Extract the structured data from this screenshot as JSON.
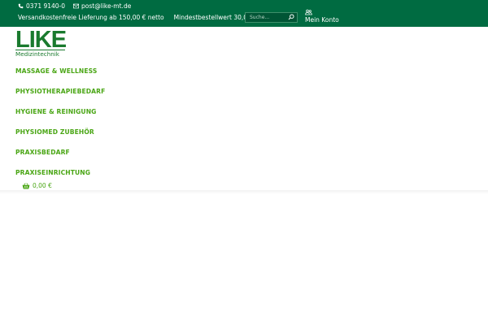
{
  "topbar": {
    "phone": "0371 9140-0",
    "email": "post@like-mt.de",
    "shipping_notice": "Versandkostenfreie Lieferung ab 150,00 € netto",
    "min_order": "Mindestbestellwert 30,00 € netto",
    "search_placeholder": "Suche...",
    "account_label": "Mein Konto",
    "icons": {
      "phone": "phone-icon",
      "email": "envelope-icon",
      "search": "search-icon",
      "account": "users-icon"
    }
  },
  "logo": {
    "word": "LIKE",
    "subtitle": "Medizintechnik"
  },
  "nav": {
    "items": [
      {
        "label": "MASSAGE & WELLNESS"
      },
      {
        "label": "PHYSIOTHERAPIEBEDARF"
      },
      {
        "label": "HYGIENE & REINIGUNG"
      },
      {
        "label": "PHYSIOMED ZUBEHÖR"
      },
      {
        "label": "PRAXISBEDARF"
      },
      {
        "label": "PRAXISEINRICHTUNG"
      }
    ]
  },
  "cart": {
    "amount": "0,00 €",
    "icon": "basket-icon"
  },
  "colors": {
    "topbar_bg": "#006b41",
    "accent_green": "#4aa615",
    "logo_green": "#1a7a2e"
  }
}
